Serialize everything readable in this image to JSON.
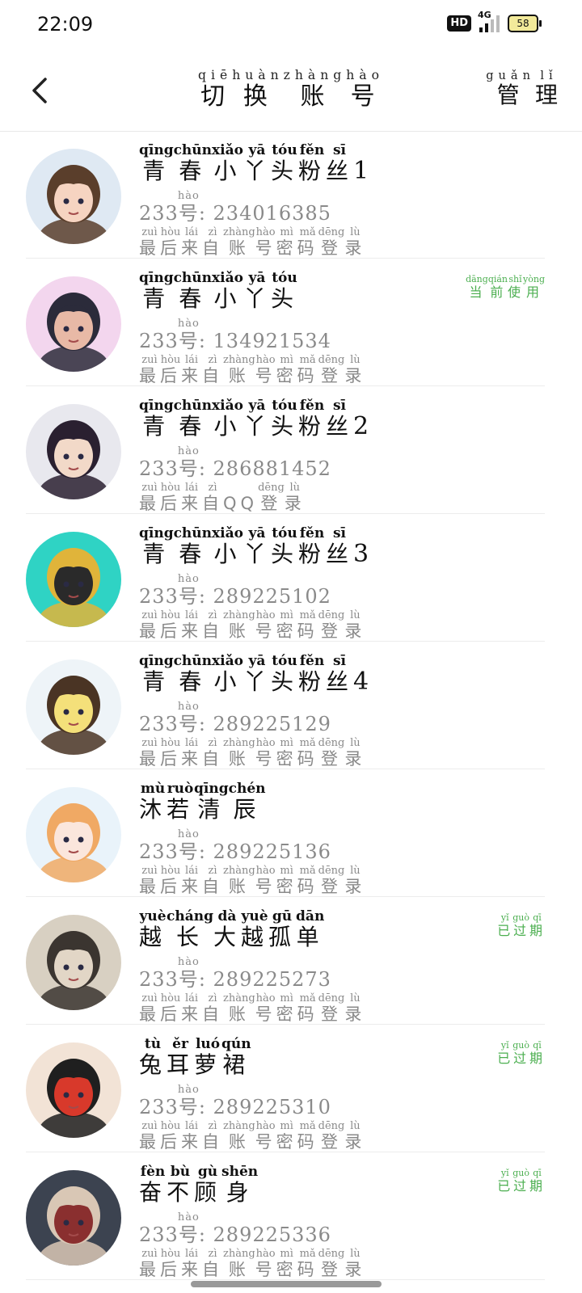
{
  "status_bar": {
    "time": "22:09",
    "hd_label": "HD",
    "network_label": "4G",
    "battery_level": "58"
  },
  "header": {
    "title": {
      "chars": [
        "切",
        "换",
        "账",
        "号"
      ],
      "pinyin": [
        "qiē",
        "huàn",
        "zhàng",
        "hào"
      ]
    },
    "manage": {
      "chars": [
        "管",
        "理"
      ],
      "pinyin": [
        "guǎn",
        "lǐ"
      ]
    }
  },
  "colors": {
    "accent_green": "#4caf50",
    "text_primary": "#111111",
    "text_secondary": "#8a8a8a",
    "divider": "#ececec"
  },
  "uid_prefix_number": "233",
  "uid_hao": {
    "char": "号",
    "pinyin": "hào"
  },
  "accounts": [
    {
      "name_chars": [
        "青",
        "春",
        "小",
        "丫",
        "头",
        "粉",
        "丝"
      ],
      "name_pinyin": [
        "qīng",
        "chūn",
        "xiǎo",
        "yā",
        "tóu",
        "fěn",
        "sī"
      ],
      "name_suffix": "1",
      "uid": ": 234016385",
      "last_chars": [
        "最",
        "后",
        "来",
        "自",
        "账",
        "号",
        "密",
        "码",
        "登",
        "录"
      ],
      "last_pinyin": [
        "zuì",
        "hòu",
        "lái",
        "zì",
        "zhàng",
        "hào",
        "mì",
        "mǎ",
        "dēng",
        "lù"
      ],
      "badge_chars": [],
      "badge_pinyin": [],
      "badge_color": "",
      "avatar_icon": "anime-girl-avatar",
      "avatar_colors": [
        "#dfe9f3",
        "#5a3e2b",
        "#f6d4c1"
      ]
    },
    {
      "name_chars": [
        "青",
        "春",
        "小",
        "丫",
        "头"
      ],
      "name_pinyin": [
        "qīng",
        "chūn",
        "xiǎo",
        "yā",
        "tóu"
      ],
      "name_suffix": "",
      "uid": ": 134921534",
      "last_chars": [
        "最",
        "后",
        "来",
        "自",
        "账",
        "号",
        "密",
        "码",
        "登",
        "录"
      ],
      "last_pinyin": [
        "zuì",
        "hòu",
        "lái",
        "zì",
        "zhàng",
        "hào",
        "mì",
        "mǎ",
        "dēng",
        "lù"
      ],
      "badge_chars": [
        "当",
        "前",
        "使",
        "用"
      ],
      "badge_pinyin": [
        "dāng",
        "qián",
        "shǐ",
        "yòng"
      ],
      "badge_color": "#4caf50",
      "avatar_icon": "anime-figure-avatar",
      "avatar_colors": [
        "#f3d6ee",
        "#2b2b3a",
        "#e8b9a6"
      ]
    },
    {
      "name_chars": [
        "青",
        "春",
        "小",
        "丫",
        "头",
        "粉",
        "丝"
      ],
      "name_pinyin": [
        "qīng",
        "chūn",
        "xiǎo",
        "yā",
        "tóu",
        "fěn",
        "sī"
      ],
      "name_suffix": "2",
      "uid": ": 286881452",
      "last_chars": [
        "最",
        "后",
        "来",
        "自",
        "QQ",
        "登",
        "录"
      ],
      "last_pinyin": [
        "zuì",
        "hòu",
        "lái",
        "zì",
        "",
        "dēng",
        "lù"
      ],
      "badge_chars": [],
      "badge_pinyin": [],
      "badge_color": "",
      "avatar_icon": "anime-girl-avatar",
      "avatar_colors": [
        "#e8e8ee",
        "#2a2030",
        "#f2d9c8"
      ]
    },
    {
      "name_chars": [
        "青",
        "春",
        "小",
        "丫",
        "头",
        "粉",
        "丝"
      ],
      "name_pinyin": [
        "qīng",
        "chūn",
        "xiǎo",
        "yā",
        "tóu",
        "fěn",
        "sī"
      ],
      "name_suffix": "3",
      "uid": ": 289225102",
      "last_chars": [
        "最",
        "后",
        "来",
        "自",
        "账",
        "号",
        "密",
        "码",
        "登",
        "录"
      ],
      "last_pinyin": [
        "zuì",
        "hòu",
        "lái",
        "zì",
        "zhàng",
        "hào",
        "mì",
        "mǎ",
        "dēng",
        "lù"
      ],
      "badge_chars": [],
      "badge_pinyin": [],
      "badge_color": "",
      "avatar_icon": "anime-boy-avatar",
      "avatar_colors": [
        "#2fd3c4",
        "#e0b43a",
        "#2a2a2a"
      ]
    },
    {
      "name_chars": [
        "青",
        "春",
        "小",
        "丫",
        "头",
        "粉",
        "丝"
      ],
      "name_pinyin": [
        "qīng",
        "chūn",
        "xiǎo",
        "yā",
        "tóu",
        "fěn",
        "sī"
      ],
      "name_suffix": "4",
      "uid": ": 289225129",
      "last_chars": [
        "最",
        "后",
        "来",
        "自",
        "账",
        "号",
        "密",
        "码",
        "登",
        "录"
      ],
      "last_pinyin": [
        "zuì",
        "hòu",
        "lái",
        "zì",
        "zhàng",
        "hào",
        "mì",
        "mǎ",
        "dēng",
        "lù"
      ],
      "badge_chars": [],
      "badge_pinyin": [],
      "badge_color": "",
      "avatar_icon": "anime-girl-avatar",
      "avatar_colors": [
        "#eef4f8",
        "#4a3424",
        "#f4e07a"
      ]
    },
    {
      "name_chars": [
        "沐",
        "若",
        "清",
        "辰"
      ],
      "name_pinyin": [
        "mù",
        "ruò",
        "qīng",
        "chén"
      ],
      "name_suffix": "",
      "uid": ": 289225136",
      "last_chars": [
        "最",
        "后",
        "来",
        "自",
        "账",
        "号",
        "密",
        "码",
        "登",
        "录"
      ],
      "last_pinyin": [
        "zuì",
        "hòu",
        "lái",
        "zì",
        "zhàng",
        "hào",
        "mì",
        "mǎ",
        "dēng",
        "lù"
      ],
      "badge_chars": [],
      "badge_pinyin": [],
      "badge_color": "",
      "avatar_icon": "anime-girl-avatar",
      "avatar_colors": [
        "#e9f3fa",
        "#f0a964",
        "#fbe6dc"
      ]
    },
    {
      "name_chars": [
        "越",
        "长",
        "大",
        "越",
        "孤",
        "单"
      ],
      "name_pinyin": [
        "yuè",
        "cháng",
        "dà",
        "yuè",
        "gū",
        "dān"
      ],
      "name_suffix": "",
      "uid": ": 289225273",
      "last_chars": [
        "最",
        "后",
        "来",
        "自",
        "账",
        "号",
        "密",
        "码",
        "登",
        "录"
      ],
      "last_pinyin": [
        "zuì",
        "hòu",
        "lái",
        "zì",
        "zhàng",
        "hào",
        "mì",
        "mǎ",
        "dēng",
        "lù"
      ],
      "badge_chars": [
        "已",
        "过",
        "期"
      ],
      "badge_pinyin": [
        "yǐ",
        "guò",
        "qī"
      ],
      "badge_color": "#4caf50",
      "avatar_icon": "illustrated-man-avatar",
      "avatar_colors": [
        "#d8d0c2",
        "#3b3530",
        "#e2d6c6"
      ]
    },
    {
      "name_chars": [
        "兔",
        "耳",
        "萝",
        "裙"
      ],
      "name_pinyin": [
        "tù",
        "ěr",
        "luó",
        "qún"
      ],
      "name_suffix": "",
      "uid": ": 289225310",
      "last_chars": [
        "最",
        "后",
        "来",
        "自",
        "账",
        "号",
        "密",
        "码",
        "登",
        "录"
      ],
      "last_pinyin": [
        "zuì",
        "hòu",
        "lái",
        "zì",
        "zhàng",
        "hào",
        "mì",
        "mǎ",
        "dēng",
        "lù"
      ],
      "badge_chars": [
        "已",
        "过",
        "期"
      ],
      "badge_pinyin": [
        "yǐ",
        "guò",
        "qī"
      ],
      "badge_color": "#4caf50",
      "avatar_icon": "cartoon-boy-noodles-avatar",
      "avatar_colors": [
        "#f2e3d6",
        "#1f1f1f",
        "#d8392b"
      ]
    },
    {
      "name_chars": [
        "奋",
        "不",
        "顾",
        "身"
      ],
      "name_pinyin": [
        "fèn",
        "bù",
        "gù",
        "shēn"
      ],
      "name_suffix": "",
      "uid": ": 289225336",
      "last_chars": [
        "最",
        "后",
        "来",
        "自",
        "账",
        "号",
        "密",
        "码",
        "登",
        "录"
      ],
      "last_pinyin": [
        "zuì",
        "hòu",
        "lái",
        "zì",
        "zhàng",
        "hào",
        "mì",
        "mǎ",
        "dēng",
        "lù"
      ],
      "badge_chars": [
        "已",
        "过",
        "期"
      ],
      "badge_pinyin": [
        "yǐ",
        "guò",
        "qī"
      ],
      "badge_color": "#4caf50",
      "avatar_icon": "illustrated-woman-avatar",
      "avatar_colors": [
        "#3c4350",
        "#d9c7b5",
        "#8a2f2f"
      ]
    }
  ]
}
